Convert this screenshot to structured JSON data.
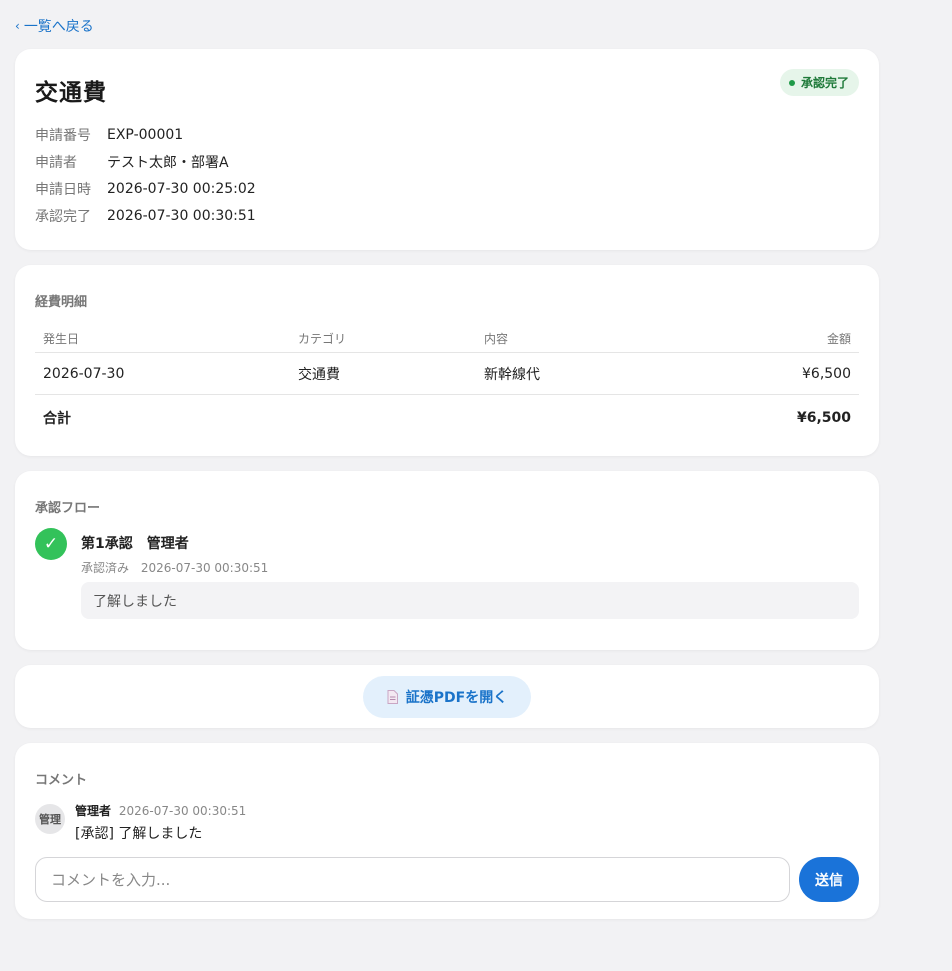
{
  "nav": {
    "back_label": "一覧へ戻る",
    "back_chevron": "‹"
  },
  "header": {
    "title": "交通費",
    "status": "承認完了",
    "meta": [
      {
        "key": "申請番号",
        "value": "EXP-00001"
      },
      {
        "key": "申請者",
        "value": "テスト太郎・部署A"
      },
      {
        "key": "申請日時",
        "value": "2026-07-30 00:25:02"
      },
      {
        "key": "承認完了",
        "value": "2026-07-30 00:30:51"
      }
    ]
  },
  "items": {
    "section_title": "経費明細",
    "columns": [
      "発生日",
      "カテゴリ",
      "内容",
      "金額"
    ],
    "rows": [
      {
        "date": "2026-07-30",
        "category": "交通費",
        "description": "新幹線代",
        "amount": "¥6,500"
      }
    ],
    "total_label": "合計",
    "total_amount": "¥6,500"
  },
  "flow": {
    "section_title": "承認フロー",
    "steps": [
      {
        "title": "第1承認　管理者",
        "status": "承認済み",
        "time": "2026-07-30 00:30:51",
        "comment": "了解しました",
        "icon": "check-icon"
      }
    ]
  },
  "pdf": {
    "button_label": "証憑PDFを開く",
    "icon": "document-icon"
  },
  "comments": {
    "section_title": "コメント",
    "list": [
      {
        "avatar": "管理",
        "author": "管理者",
        "time": "2026-07-30 00:30:51",
        "text": "[承認] 了解しました"
      }
    ],
    "input_placeholder": "コメントを入力...",
    "send_label": "送信"
  },
  "colors": {
    "accent": "#1a73c9",
    "success": "#33c25a",
    "badge_bg": "#e6f5ea",
    "badge_text": "#1f7a3a",
    "page_bg": "#f2f2f4"
  }
}
